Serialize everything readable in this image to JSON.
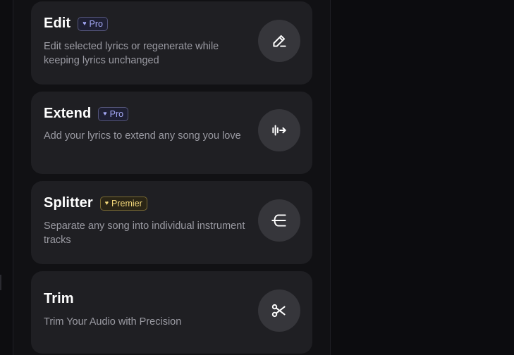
{
  "tools": [
    {
      "title": "Edit",
      "badge": {
        "label": "Pro",
        "icon": "gem-icon",
        "tier": "pro"
      },
      "description": "Edit selected lyrics or regenerate while keeping lyrics unchanged",
      "icon": "edit-pencil-icon"
    },
    {
      "title": "Extend",
      "badge": {
        "label": "Pro",
        "icon": "gem-icon",
        "tier": "pro"
      },
      "description": "Add your lyrics to extend any song you love",
      "icon": "extend-waveform-arrow-icon"
    },
    {
      "title": "Splitter",
      "badge": {
        "label": "Premier",
        "icon": "gem-icon",
        "tier": "premier"
      },
      "description": "Separate any song into individual instrument tracks",
      "icon": "split-tracks-icon"
    },
    {
      "title": "Trim",
      "badge": null,
      "description": "Trim Your Audio with Precision",
      "icon": "scissors-icon"
    }
  ],
  "colors": {
    "background": "#0c0c0f",
    "panel": "#111114",
    "card": "#1f1f23",
    "icon_button": "#36363b",
    "pro_badge_text": "#a4a8f5",
    "premier_badge_text": "#f2d77a",
    "description_text": "#9b9ba3"
  }
}
